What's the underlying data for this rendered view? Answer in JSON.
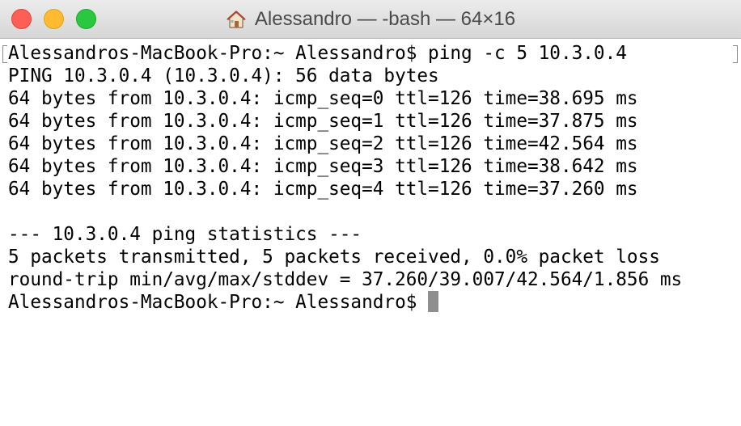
{
  "window": {
    "title": "Alessandro — -bash — 64×16",
    "title_icon": "home-icon",
    "traffic_lights": {
      "close": "#fd5f57",
      "minimize": "#febc2e",
      "maximize": "#28c840"
    }
  },
  "terminal": {
    "lines": [
      "Alessandros-MacBook-Pro:~ Alessandro$ ping -c 5 10.3.0.4",
      "PING 10.3.0.4 (10.3.0.4): 56 data bytes",
      "64 bytes from 10.3.0.4: icmp_seq=0 ttl=126 time=38.695 ms",
      "64 bytes from 10.3.0.4: icmp_seq=1 ttl=126 time=37.875 ms",
      "64 bytes from 10.3.0.4: icmp_seq=2 ttl=126 time=42.564 ms",
      "64 bytes from 10.3.0.4: icmp_seq=3 ttl=126 time=38.642 ms",
      "64 bytes from 10.3.0.4: icmp_seq=4 ttl=126 time=37.260 ms",
      "",
      "--- 10.3.0.4 ping statistics ---",
      "5 packets transmitted, 5 packets received, 0.0% packet loss",
      "round-trip min/avg/max/stddev = 37.260/39.007/42.564/1.856 ms"
    ],
    "prompt": "Alessandros-MacBook-Pro:~ Alessandro$ ",
    "cursor_color": "#8e8e8e",
    "text_color": "#000000",
    "background": "#ffffff"
  }
}
